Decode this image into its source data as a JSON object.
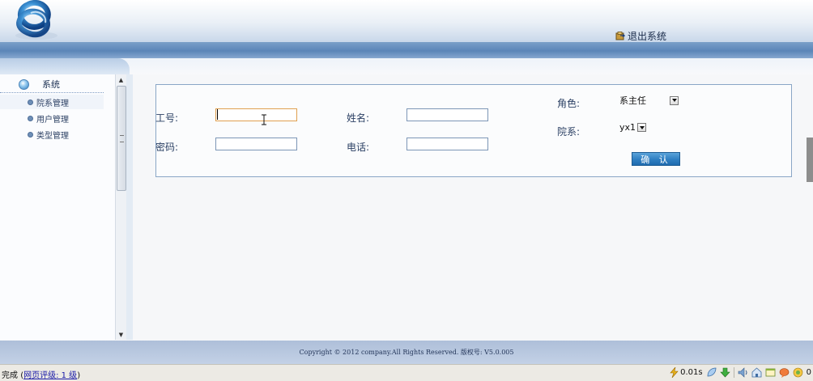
{
  "header": {
    "logout_label": "退出系统"
  },
  "sidebar": {
    "group_label": "系统",
    "items": [
      {
        "label": "院系管理"
      },
      {
        "label": "用户管理"
      },
      {
        "label": "类型管理"
      }
    ]
  },
  "form": {
    "emp_id": {
      "label": "工号:",
      "value": ""
    },
    "name": {
      "label": "姓名:",
      "value": ""
    },
    "password": {
      "label": "密码:",
      "value": ""
    },
    "phone": {
      "label": "电话:",
      "value": ""
    },
    "role": {
      "label": "角色:",
      "selected": "系主任"
    },
    "dept": {
      "label": "院系:",
      "selected": "yx1"
    },
    "confirm_label": "确 认"
  },
  "footer": {
    "copyright": "Copyright © 2012 company.All Rights Reserved. 版权号: V5.0.005"
  },
  "statusbar": {
    "done": "完成",
    "rating_open": "(",
    "rating_link": "网页评级: 1 级",
    "rating_close": ")",
    "timing": "0.01s",
    "counter": "0"
  },
  "colors": {
    "accent": "#2f7fc2",
    "header_band": "#5b85b8",
    "footer": "#b7c7df"
  }
}
